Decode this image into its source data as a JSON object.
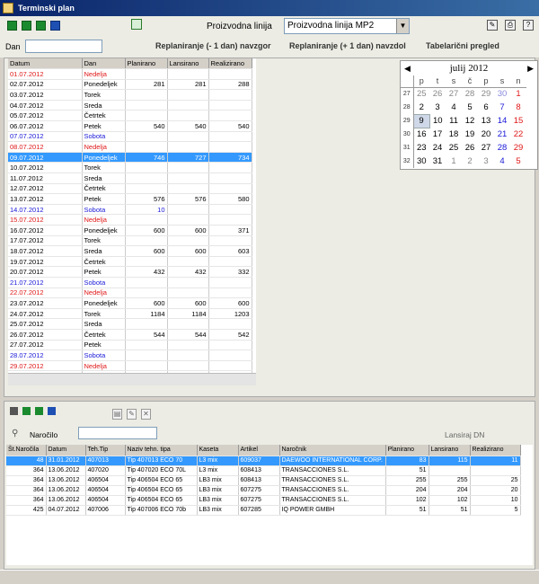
{
  "window": {
    "title": "Terminski plan"
  },
  "toolbar": {
    "line_label": "Proizvodna linija",
    "line_value": "Proizvodna linija MP2"
  },
  "filter": {
    "dan_label": "Dan",
    "dan_value": "",
    "replan_minus": "Replaniranje (- 1 dan) navzgor",
    "replan_plus": "Replaniranje (+ 1 dan) navzdol",
    "tabular": "Tabelarični pregled"
  },
  "grid": {
    "headers": [
      "Datum",
      "Dan",
      "Planirano",
      "Lansirano",
      "Realizirano"
    ],
    "rows": [
      {
        "d": "01.07.2012",
        "dan": "Nedelja",
        "p": "",
        "l": "",
        "r": "",
        "t": "red"
      },
      {
        "d": "02.07.2012",
        "dan": "Ponedeljek",
        "p": "281",
        "l": "281",
        "r": "288",
        "t": ""
      },
      {
        "d": "03.07.2012",
        "dan": "Torek",
        "p": "",
        "l": "",
        "r": "",
        "t": ""
      },
      {
        "d": "04.07.2012",
        "dan": "Sreda",
        "p": "",
        "l": "",
        "r": "",
        "t": ""
      },
      {
        "d": "05.07.2012",
        "dan": "Četrtek",
        "p": "",
        "l": "",
        "r": "",
        "t": ""
      },
      {
        "d": "06.07.2012",
        "dan": "Petek",
        "p": "540",
        "l": "540",
        "r": "540",
        "t": ""
      },
      {
        "d": "07.07.2012",
        "dan": "Sobota",
        "p": "",
        "l": "",
        "r": "",
        "t": "blue"
      },
      {
        "d": "08.07.2012",
        "dan": "Nedelja",
        "p": "",
        "l": "",
        "r": "",
        "t": "red"
      },
      {
        "d": "09.07.2012",
        "dan": "Ponedeljek",
        "p": "746",
        "l": "727",
        "r": "734",
        "t": "sel"
      },
      {
        "d": "10.07.2012",
        "dan": "Torek",
        "p": "",
        "l": "",
        "r": "",
        "t": ""
      },
      {
        "d": "11.07.2012",
        "dan": "Sreda",
        "p": "",
        "l": "",
        "r": "",
        "t": ""
      },
      {
        "d": "12.07.2012",
        "dan": "Četrtek",
        "p": "",
        "l": "",
        "r": "",
        "t": ""
      },
      {
        "d": "13.07.2012",
        "dan": "Petek",
        "p": "576",
        "l": "576",
        "r": "580",
        "t": ""
      },
      {
        "d": "14.07.2012",
        "dan": "Sobota",
        "p": "10",
        "l": "",
        "r": "",
        "t": "blue"
      },
      {
        "d": "15.07.2012",
        "dan": "Nedelja",
        "p": "",
        "l": "",
        "r": "",
        "t": "red"
      },
      {
        "d": "16.07.2012",
        "dan": "Ponedeljek",
        "p": "600",
        "l": "600",
        "r": "371",
        "t": ""
      },
      {
        "d": "17.07.2012",
        "dan": "Torek",
        "p": "",
        "l": "",
        "r": "",
        "t": ""
      },
      {
        "d": "18.07.2012",
        "dan": "Sreda",
        "p": "600",
        "l": "600",
        "r": "603",
        "t": ""
      },
      {
        "d": "19.07.2012",
        "dan": "Četrtek",
        "p": "",
        "l": "",
        "r": "",
        "t": ""
      },
      {
        "d": "20.07.2012",
        "dan": "Petek",
        "p": "432",
        "l": "432",
        "r": "332",
        "t": ""
      },
      {
        "d": "21.07.2012",
        "dan": "Sobota",
        "p": "",
        "l": "",
        "r": "",
        "t": "blue"
      },
      {
        "d": "22.07.2012",
        "dan": "Nedelja",
        "p": "",
        "l": "",
        "r": "",
        "t": "red"
      },
      {
        "d": "23.07.2012",
        "dan": "Ponedeljek",
        "p": "600",
        "l": "600",
        "r": "600",
        "t": ""
      },
      {
        "d": "24.07.2012",
        "dan": "Torek",
        "p": "1184",
        "l": "1184",
        "r": "1203",
        "t": ""
      },
      {
        "d": "25.07.2012",
        "dan": "Sreda",
        "p": "",
        "l": "",
        "r": "",
        "t": ""
      },
      {
        "d": "26.07.2012",
        "dan": "Četrtek",
        "p": "544",
        "l": "544",
        "r": "542",
        "t": ""
      },
      {
        "d": "27.07.2012",
        "dan": "Petek",
        "p": "",
        "l": "",
        "r": "",
        "t": ""
      },
      {
        "d": "28.07.2012",
        "dan": "Sobota",
        "p": "",
        "l": "",
        "r": "",
        "t": "blue"
      },
      {
        "d": "29.07.2012",
        "dan": "Nedelja",
        "p": "",
        "l": "",
        "r": "",
        "t": "red"
      },
      {
        "d": "30.07.2012",
        "dan": "Ponedeljek",
        "p": "",
        "l": "",
        "r": "",
        "t": ""
      },
      {
        "d": "31.07.2012",
        "dan": "Torek",
        "p": "",
        "l": "",
        "r": "",
        "t": ""
      }
    ]
  },
  "calendar": {
    "title": "julij 2012",
    "day_headers": [
      "p",
      "t",
      "s",
      "č",
      "p",
      "s",
      "n"
    ],
    "weeks": [
      {
        "wk": "27",
        "days": [
          [
            "25",
            "prev"
          ],
          [
            "26",
            "prev"
          ],
          [
            "27",
            "prev"
          ],
          [
            "28",
            "prev"
          ],
          [
            "29",
            "prev"
          ],
          [
            "30",
            "prev sat"
          ],
          [
            "1",
            "sun"
          ]
        ]
      },
      {
        "wk": "28",
        "days": [
          [
            "2",
            ""
          ],
          [
            "3",
            ""
          ],
          [
            "4",
            ""
          ],
          [
            "5",
            ""
          ],
          [
            "6",
            ""
          ],
          [
            "7",
            "sat"
          ],
          [
            "8",
            "sun"
          ]
        ]
      },
      {
        "wk": "29",
        "days": [
          [
            "9",
            "today"
          ],
          [
            "10",
            ""
          ],
          [
            "11",
            ""
          ],
          [
            "12",
            ""
          ],
          [
            "13",
            ""
          ],
          [
            "14",
            "sat"
          ],
          [
            "15",
            "sun"
          ]
        ]
      },
      {
        "wk": "30",
        "days": [
          [
            "16",
            ""
          ],
          [
            "17",
            ""
          ],
          [
            "18",
            ""
          ],
          [
            "19",
            ""
          ],
          [
            "20",
            ""
          ],
          [
            "21",
            "sat"
          ],
          [
            "22",
            "sun"
          ]
        ]
      },
      {
        "wk": "31",
        "days": [
          [
            "23",
            ""
          ],
          [
            "24",
            ""
          ],
          [
            "25",
            ""
          ],
          [
            "26",
            ""
          ],
          [
            "27",
            ""
          ],
          [
            "28",
            "sat"
          ],
          [
            "29",
            "sun"
          ]
        ]
      },
      {
        "wk": "32",
        "days": [
          [
            "30",
            ""
          ],
          [
            "31",
            ""
          ],
          [
            "1",
            "prev"
          ],
          [
            "2",
            "prev"
          ],
          [
            "3",
            "prev"
          ],
          [
            "4",
            "sat"
          ],
          [
            "5",
            "sun"
          ]
        ]
      }
    ]
  },
  "lower": {
    "narocilo_label": "Naročilo",
    "narocilo_value": "",
    "lansirano_label": "Lansiraj DN",
    "headers": [
      "Št.Naročila",
      "Datum",
      "Teh.Tip",
      "Naziv tehn. tipa",
      "Kaseta",
      "Artikel",
      "Naročnik",
      "Planirano",
      "Lansirano",
      "Realizirano"
    ],
    "rows": [
      [
        "48",
        "31.01.2012",
        "407013",
        "Tip 407013 ECO 70",
        "L3 mix",
        "609037",
        "DAEWOO INTERNATIONAL CORP.",
        "83",
        "115",
        "11"
      ],
      [
        "364",
        "13.06.2012",
        "407020",
        "Tip 407020 ECO 70L",
        "L3 mix",
        "608413",
        "TRANSACCIONES S.L.",
        "51",
        "",
        ""
      ],
      [
        "364",
        "13.06.2012",
        "406504",
        "Tip 406504 ECO 65",
        "LB3 mix",
        "608413",
        "TRANSACCIONES S.L.",
        "255",
        "255",
        "25"
      ],
      [
        "364",
        "13.06.2012",
        "406504",
        "Tip 406504 ECO 65",
        "LB3 mix",
        "607275",
        "TRANSACCIONES S.L.",
        "204",
        "204",
        "20"
      ],
      [
        "364",
        "13.06.2012",
        "406504",
        "Tip 406504 ECO 65",
        "LB3 mix",
        "607275",
        "TRANSACCIONES S.L.",
        "102",
        "102",
        "10"
      ],
      [
        "425",
        "04.07.2012",
        "407006",
        "Tip 407006 ECO 70b",
        "LB3 mix",
        "607285",
        "IQ POWER GMBH",
        "51",
        "51",
        "5"
      ]
    ]
  }
}
